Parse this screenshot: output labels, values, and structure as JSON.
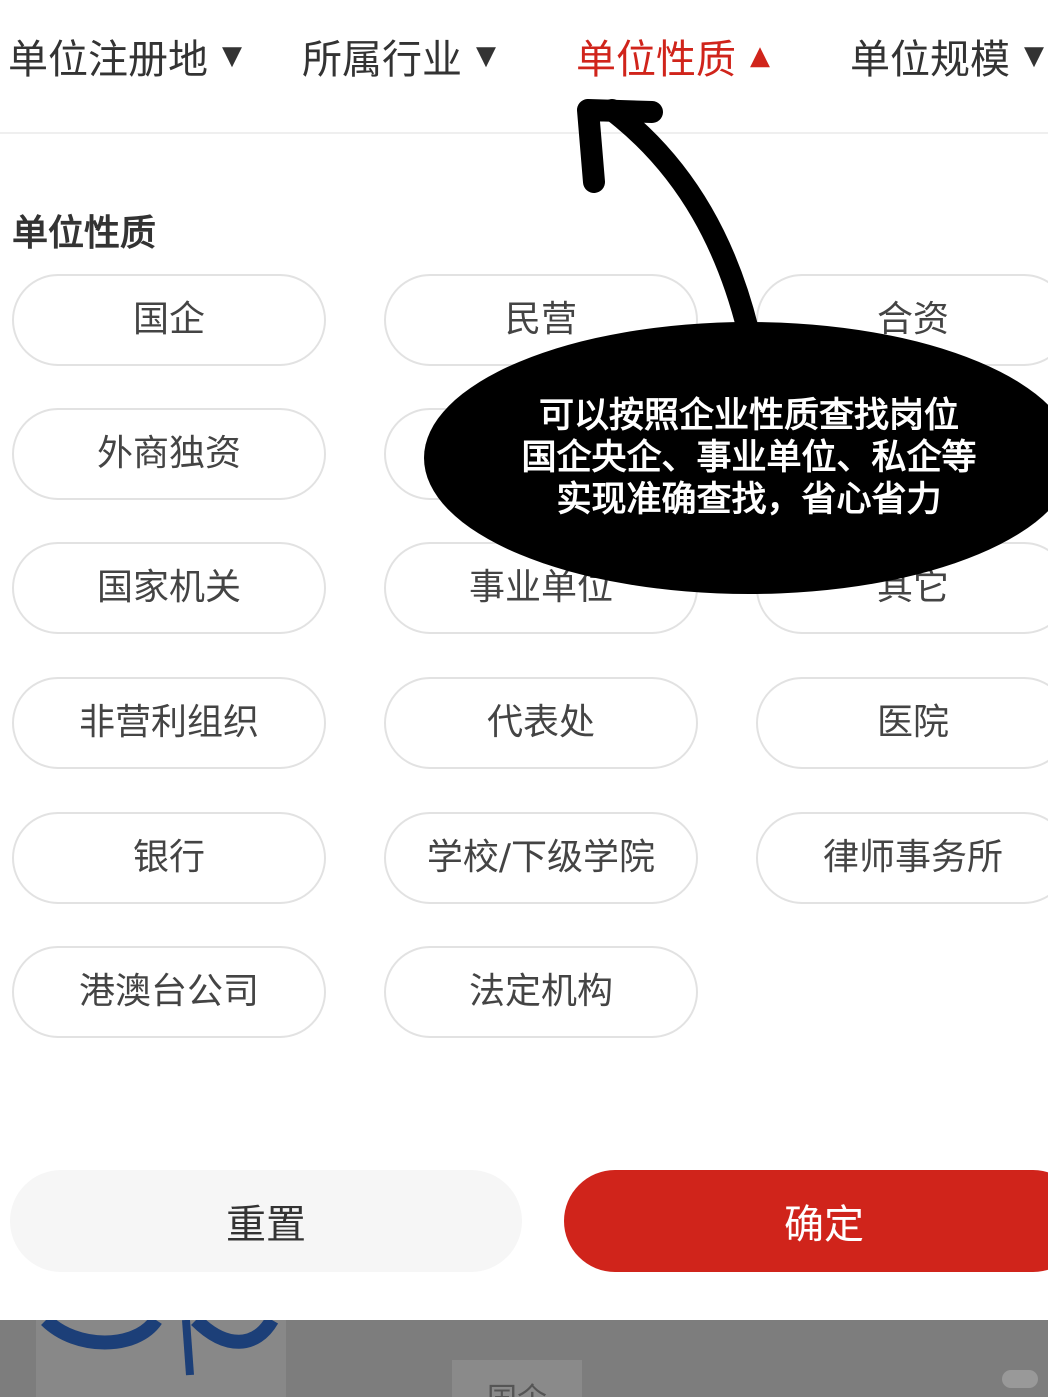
{
  "filter_bar": {
    "tabs": [
      {
        "label": "单位注册地",
        "caret": "▼"
      },
      {
        "label": "所属行业",
        "caret": "▼"
      },
      {
        "label": "单位性质",
        "caret": "▲"
      },
      {
        "label": "单位规模",
        "caret": "▼"
      }
    ],
    "active_index": 2
  },
  "section": {
    "title": "单位性质",
    "options": [
      "国企",
      "民营",
      "合资",
      "外商独资",
      "",
      "",
      "国家机关",
      "事业单位",
      "其它",
      "非营利组织",
      "代表处",
      "医院",
      "银行",
      "学校/下级学院",
      "律师事务所",
      "港澳台公司",
      "法定机构"
    ]
  },
  "annotation": {
    "lines": [
      "可以按照企业性质查找岗位",
      "国企央企、事业单位、私企等",
      "实现准确查找，省心省力"
    ]
  },
  "actions": {
    "reset_label": "重置",
    "confirm_label": "确定"
  },
  "backdrop": {
    "chip_label": "国企"
  },
  "colors": {
    "accent": "#d0241b",
    "chip_border": "#e2e2e2",
    "reset_bg": "#f6f6f6"
  }
}
